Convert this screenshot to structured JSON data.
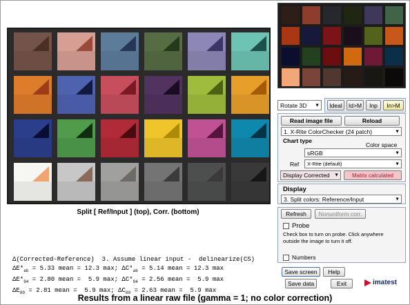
{
  "colors": {
    "checker_top": [
      "#74544a",
      "#d79f93",
      "#5d7c9c",
      "#566d44",
      "#8c87b6",
      "#6dc4b4",
      "#dd7c2b",
      "#4e62b0",
      "#c74f5c",
      "#52335f",
      "#9fbd3d",
      "#e89f2a",
      "#2b3e8c",
      "#4f9c4c",
      "#b12a38",
      "#efc52b",
      "#c05294",
      "#0f88ad",
      "#f6f6f3",
      "#c6c7c6",
      "#a0a09f",
      "#747474",
      "#4d4e4e",
      "#383938"
    ],
    "checker_corner": [
      "#4a2f24",
      "#9a4a3b",
      "#243754",
      "#243a1a",
      "#3a3768",
      "#1f4f4b",
      "#9d3b1a",
      "#11193f",
      "#7a1a22",
      "#1a0d21",
      "#4c6112",
      "#a45a07",
      "#070d33",
      "#112d10",
      "#4a0a10",
      "#ad8a08",
      "#56133d",
      "#053447",
      "#f0a46f",
      "#8a6a58",
      "#6e6b66",
      "#3b3b3b",
      "#3b3a38",
      "#161616"
    ],
    "mini": [
      "#2e1e17",
      "#8e3d2d",
      "#26282d",
      "#1f2611",
      "#40385a",
      "#416347",
      "#a93714",
      "#16193b",
      "#7b1418",
      "#1a0e1b",
      "#53631b",
      "#c7571a",
      "#0b0f2f",
      "#23401f",
      "#6c0d0f",
      "#d1690f",
      "#6e1a37",
      "#0a3049",
      "#f3a678",
      "#7a4438",
      "#50382e",
      "#271b16",
      "#1a1612",
      "#0b0a09"
    ]
  },
  "labels": {
    "split": "Split [ Ref/Input ] (top), Corr. (bottom)",
    "caption": "Results from a linear raw file (gamma = 1; no color correction)"
  },
  "stats": {
    "line1": "Δ(Corrected-Reference)  3. Assume linear input -  delinearize(CS)",
    "line2a": "ΔE*",
    "line2b": "ab",
    "line2c": " = 5.33 mean = 12.3 max; ΔC*",
    "line2d": "ab",
    "line2e": " = 5.14 mean = 12.3 max",
    "line3a": "ΔE*",
    "line3b": "94",
    "line3c": " = 2.80 mean =  5.9 max; ΔC*",
    "line3d": "94",
    "line3e": " = 2.56 mean =  5.9 max",
    "line4a": "ΔE",
    "line4b": "00",
    "line4c": " = 2.81 mean =  5.9 max; ΔC",
    "line4d": "00",
    "line4e": " = 2.63 mean =  5.9 max"
  },
  "controls": {
    "rotate": "Rotate 3D",
    "view_buttons": [
      "Ideal",
      "Id>M",
      "Inp",
      "In>M"
    ],
    "read_image": "Read image file",
    "reload": "Reload",
    "chart_select": "1.  X-Rite ColorChecker (24 patch)",
    "chart_type": "Chart type",
    "color_space_label": "Color space",
    "color_space": "sRGB",
    "ref_label": "Ref",
    "ref_value": "X-Rite (default)",
    "display_corrected": "Display Corrected",
    "matrix_calculated": "Matrix calculated",
    "display_title": "Display",
    "display_select": "3.  Split colors: Reference/Input",
    "refresh": "Refresh",
    "nonuniform": "Nonuniform corr.",
    "probe": "Probe",
    "probe_help": "Check box to turn on probe. Click anywhere outside the image to turn it off.",
    "numbers": "Numbers",
    "save_screen": "Save screen",
    "help": "Help",
    "save_data": "Save data",
    "exit": "Exit",
    "logo": "imatest"
  }
}
